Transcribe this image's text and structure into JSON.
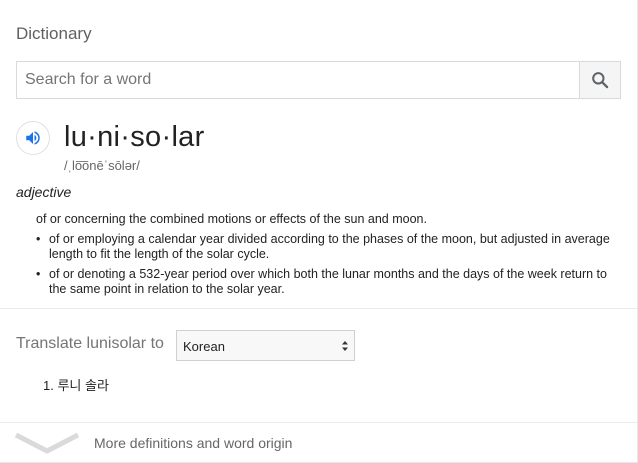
{
  "dictionary": {
    "title": "Dictionary",
    "search": {
      "placeholder": "Search for a word",
      "value": ""
    },
    "entry": {
      "word": "lu·ni·so·lar",
      "phonetic": "/ˌlo͞onēˈsōlər/",
      "part_of_speech": "adjective",
      "main_definition": "of or concerning the combined motions or effects of the sun and moon.",
      "sub_definitions": [
        "of or employing a calendar year divided according to the phases of the moon, but adjusted in average length to fit the length of the solar cycle.",
        "of or denoting a 532-year period over which both the lunar months and the days of the week return to the same point in relation to the solar year."
      ]
    },
    "translate": {
      "label": "Translate lunisolar to",
      "selected_language": "Korean",
      "results": [
        "1. 루니 솔라"
      ]
    },
    "more_label": "More definitions and word origin"
  },
  "icons": {
    "search": "search-icon",
    "speaker": "speaker-icon",
    "select_arrows": "select-arrows-icon",
    "expand": "chevron-down-icon"
  },
  "colors": {
    "accent": "#1a73e8",
    "muted_text": "#757575"
  }
}
